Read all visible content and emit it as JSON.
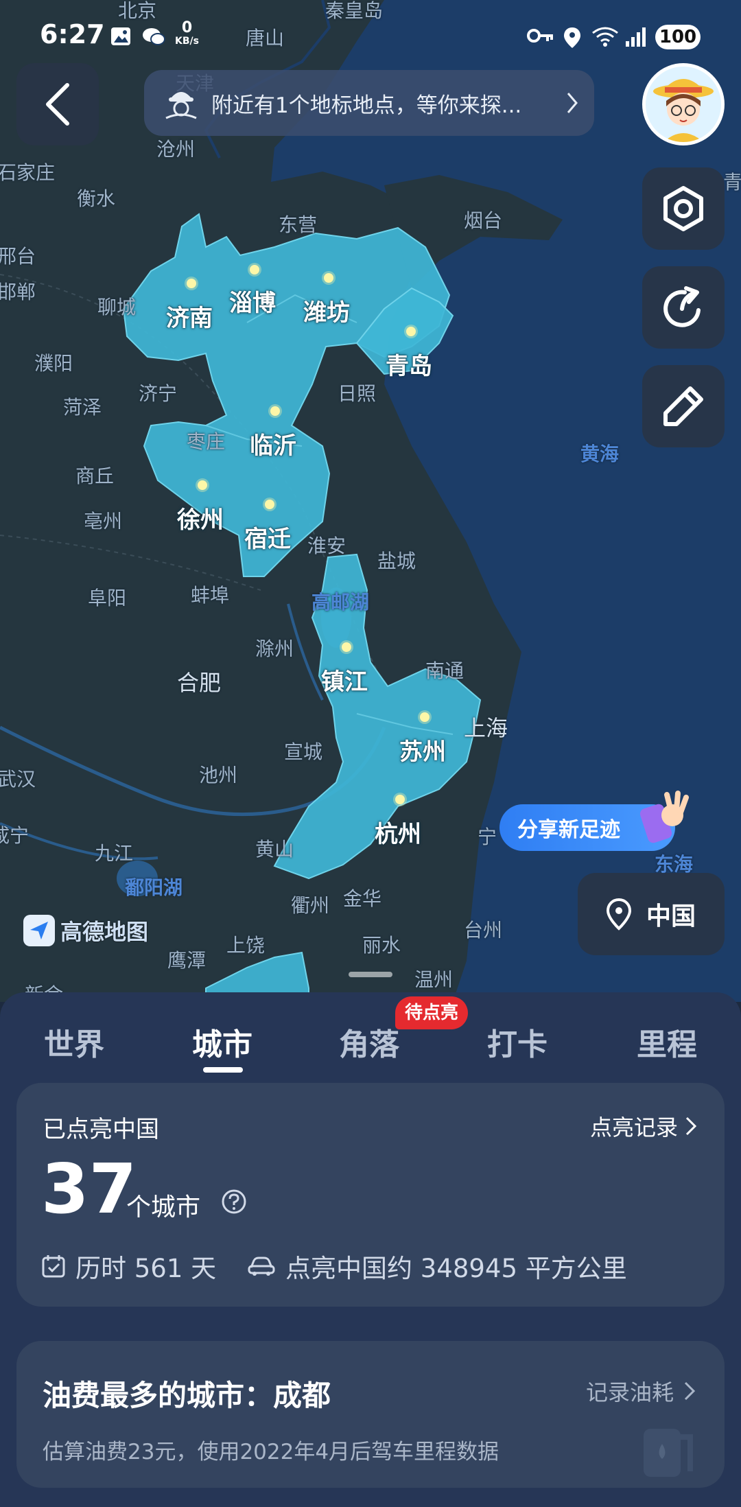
{
  "status_bar": {
    "time": "6:27",
    "net_speed": "0",
    "net_unit": "KB/s",
    "battery": "100",
    "icons": [
      "image-icon",
      "chat-icon",
      "key-icon",
      "location-icon",
      "wifi-icon",
      "signal-icon"
    ]
  },
  "banner": {
    "text": "附近有1个地标地点，等你来探..."
  },
  "map": {
    "lit_color": "#3fb6d6",
    "lit_cities": [
      "济南",
      "淄博",
      "潍坊",
      "青岛",
      "临沂",
      "徐州",
      "宿迁",
      "镇江",
      "苏州",
      "杭州"
    ],
    "labels": [
      "北京",
      "秦皇岛",
      "唐山",
      "天津",
      "沧州",
      "石家庄",
      "衡水",
      "东营",
      "烟台",
      "邢台",
      "邯郸",
      "聊城",
      "濮阳",
      "济宁",
      "日照",
      "菏泽",
      "枣庄",
      "商丘",
      "亳州",
      "淮安",
      "盐城",
      "阜阳",
      "蚌埠",
      "滁州",
      "合肥",
      "南通",
      "上海",
      "宣城",
      "池州",
      "武汉",
      "九江",
      "黄山",
      "宁",
      "衢州",
      "金华",
      "台州",
      "上饶",
      "丽水",
      "鹰潭",
      "温州",
      "咸宁",
      "新余",
      "青"
    ],
    "water_labels": [
      "黄海",
      "高邮湖",
      "鄱阳湖",
      "东海"
    ],
    "logo_text": "高德地图"
  },
  "share_button": {
    "label": "分享新足迹"
  },
  "locate_button": {
    "label": "中国"
  },
  "tabs": {
    "items": [
      "世界",
      "城市",
      "角落",
      "打卡",
      "里程"
    ],
    "active_index": 1,
    "badge": "待点亮"
  },
  "summary_card": {
    "title": "已点亮中国",
    "link": "点亮记录",
    "count": "37",
    "count_unit": "个城市",
    "duration": "历时 561 天",
    "area": "点亮中国约 348945 平方公里"
  },
  "fuel_card": {
    "title": "油费最多的城市：成都",
    "link": "记录油耗",
    "subtitle": "估算油费23元，使用2022年4月后驾车里程数据"
  }
}
